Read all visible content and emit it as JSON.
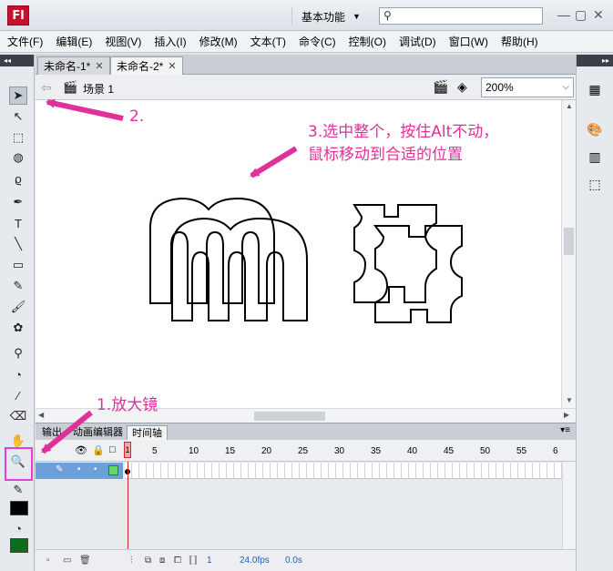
{
  "app": {
    "logo": "Fl",
    "workspace_label": "基本功能",
    "workspace_arrow": "▼",
    "search_placeholder": "",
    "window_controls": [
      "—",
      "▢",
      "✕"
    ]
  },
  "menu": [
    "文件(F)",
    "编辑(E)",
    "视图(V)",
    "插入(I)",
    "修改(M)",
    "文本(T)",
    "命令(C)",
    "控制(O)",
    "调试(D)",
    "窗口(W)",
    "帮助(H)"
  ],
  "doc_tabs": [
    {
      "label": "未命名-1*",
      "active": false
    },
    {
      "label": "未命名-2*",
      "active": true
    }
  ],
  "editbar": {
    "scene_label": "场景 1",
    "zoom": "200%"
  },
  "timeline": {
    "tabs": [
      "输出",
      "动画编辑器",
      "时间轴"
    ],
    "active_tab": "时间轴",
    "frame_numbers": [
      "5",
      "10",
      "15",
      "20",
      "25",
      "30",
      "35",
      "40",
      "45",
      "50",
      "55",
      "6"
    ],
    "playhead_frame": "1",
    "current_frame": "1",
    "fps": "24.0fps",
    "time": "0.0s"
  },
  "annotations": {
    "step1": "1.放大镜",
    "step2": "2.",
    "step3_line1": "3.选中整个，按住Alt不动，",
    "step3_line2": "鼠标移动到合适的位置"
  },
  "colors": {
    "annotation": "#e0309a",
    "highlight_box": "#e040d8",
    "layer_row": "#6f9fd8",
    "layer_color": "#63d86b",
    "stroke_color_swatch": "#000000",
    "fill_color_swatch": "#0a6e1a",
    "playhead": "#cc2a2a"
  }
}
